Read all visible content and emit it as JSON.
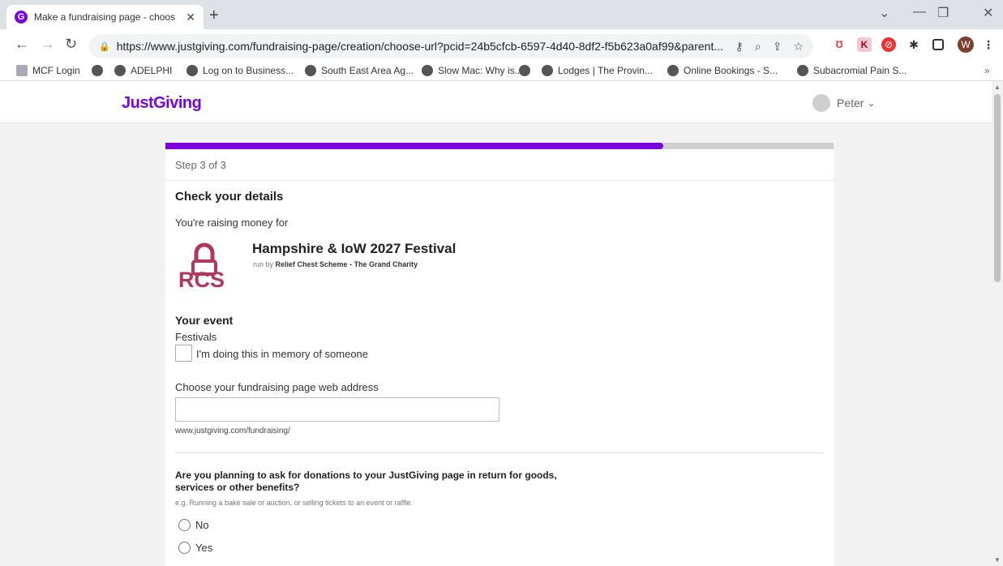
{
  "browser": {
    "tab_title": "Make a fundraising page - choos",
    "tab_close": "✕",
    "new_tab": "+",
    "url": "https://www.justgiving.com/fundraising-page/creation/choose-url?pcid=24b5cfcb-6597-4d40-8df2-f5b623a0af99&parent...",
    "profile_initial": "W",
    "bookmarks": [
      "MCF Login",
      "ADELPHI",
      "Log on to Business...",
      "South East Area Ag...",
      "Slow Mac: Why is...",
      "Lodges | The Provin...",
      "Online Bookings - S...",
      "Subacromial Pain S..."
    ],
    "bookmarks_more": "»"
  },
  "header": {
    "logo": "JustGiving",
    "user_name": "Peter"
  },
  "form": {
    "progress_fraction": 0.745,
    "step": "Step 3 of 3",
    "title": "Check your details",
    "raising_for": "You're raising money for",
    "charity": {
      "logo_text": "RCS",
      "name": "Hampshire & IoW 2027 Festival",
      "run_by_prefix": "run by",
      "run_by": "Relief Chest Scheme - The Grand Charity"
    },
    "event": {
      "heading": "Your event",
      "value": "Festivals",
      "memory_label": "I'm doing this in memory of someone"
    },
    "web_address": {
      "label": "Choose your fundraising page web address",
      "value": "",
      "prefix": "www.justgiving.com/fundraising/"
    },
    "donations_question": {
      "question": "Are you planning to ask for donations to your JustGiving page in return for goods, services or other benefits?",
      "hint": "e.g. Running a bake sale or auction, or selling tickets to an event or raffle.",
      "options": [
        "No",
        "Yes"
      ]
    }
  },
  "colors": {
    "brand": "#7a04dd",
    "rcs": "#b0375e"
  }
}
